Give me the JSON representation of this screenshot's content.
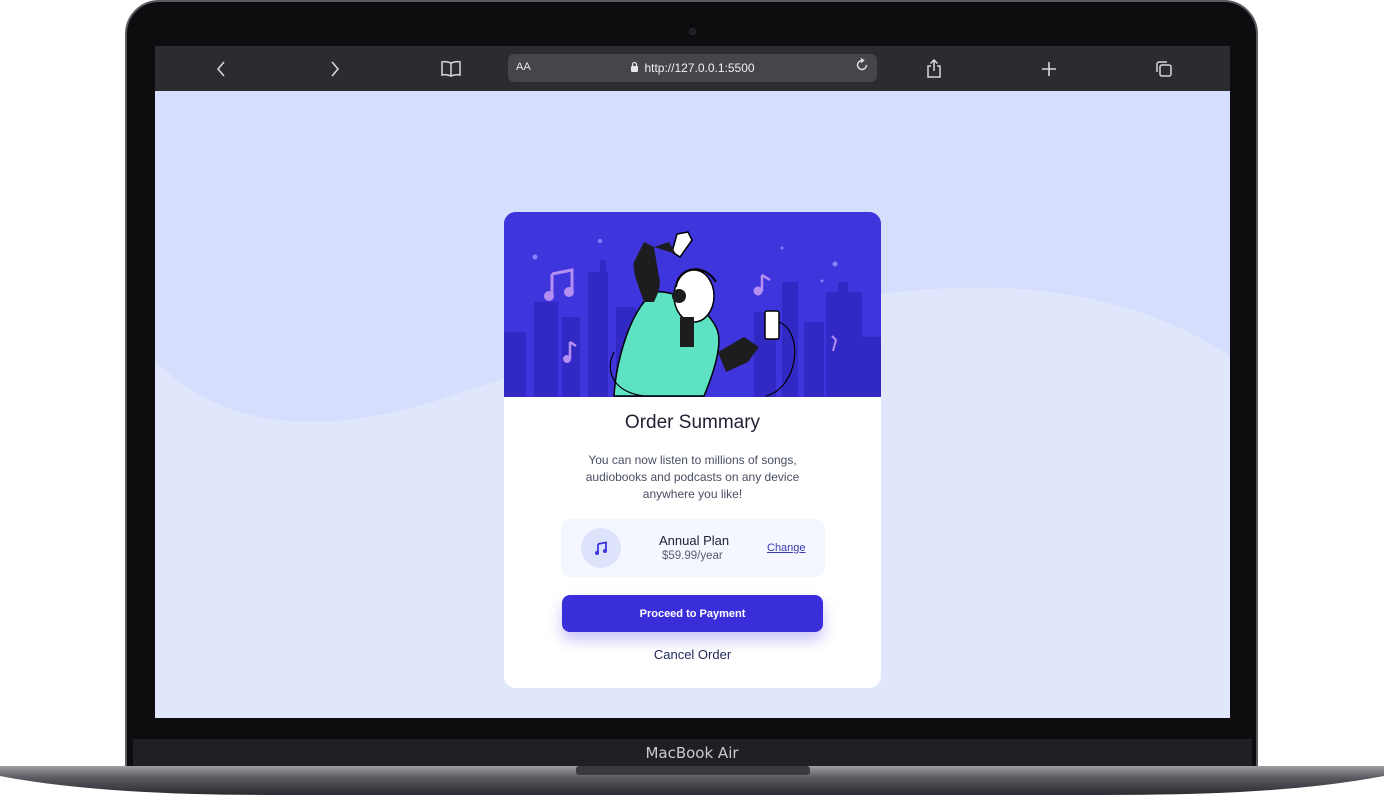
{
  "device": {
    "label": "MacBook Air"
  },
  "browser": {
    "text_size_label": "AA",
    "url": "http://127.0.0.1:5500",
    "icons": [
      "back-icon",
      "forward-icon",
      "bookmarks-icon",
      "lock-icon",
      "reload-icon",
      "share-icon",
      "new-tab-icon",
      "tabs-icon"
    ]
  },
  "order_card": {
    "title": "Order Summary",
    "description": "You can now listen to millions of songs, audiobooks and podcasts on any device anywhere you like!",
    "plan": {
      "name": "Annual Plan",
      "price": "$59.99/year",
      "change_label": "Change",
      "icon": "music-note-icon"
    },
    "primary_button": "Proceed to Payment",
    "cancel_link": "Cancel Order"
  },
  "colors": {
    "page_background": "#d6e0fd",
    "accent": "#3a2edb",
    "hero_background": "#3e35dd",
    "plan_background": "#f4f7ff"
  }
}
